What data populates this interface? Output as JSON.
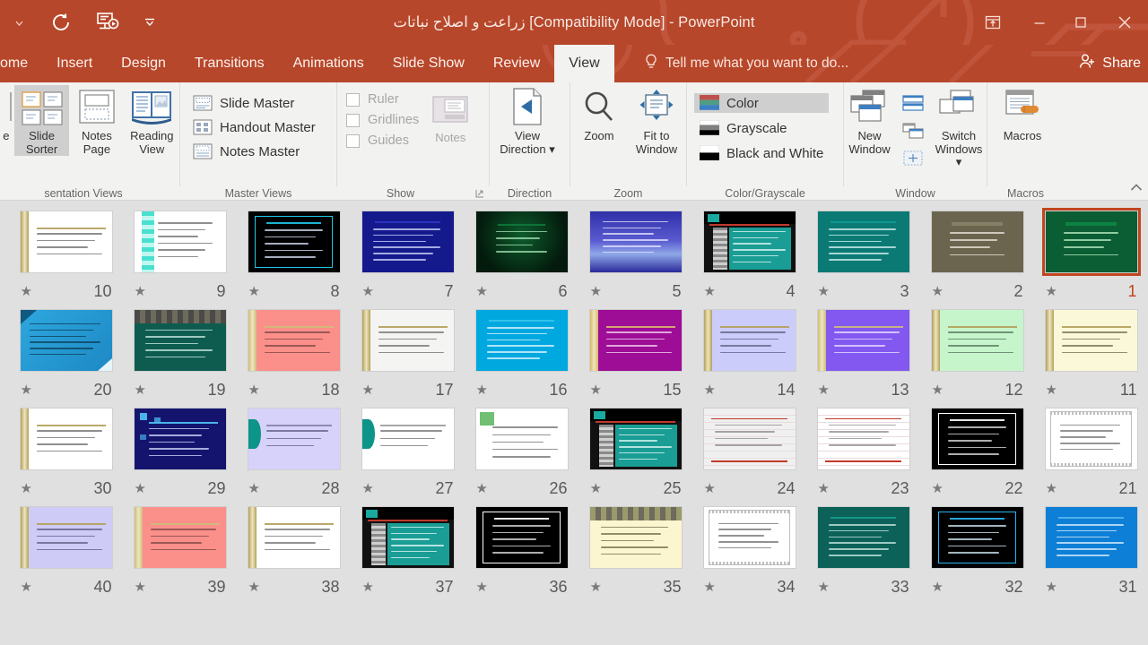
{
  "titlebar": {
    "title": "زراعت و اصلاح نباتات [Compatibility Mode] - PowerPoint",
    "quick_access": [
      {
        "name": "qat-dropdown-left",
        "glyph": "▾"
      },
      {
        "name": "undo-icon",
        "glyph": "↺"
      },
      {
        "name": "start-slideshow-icon",
        "glyph": "⎚"
      },
      {
        "name": "customize-qat-icon",
        "glyph": "▾"
      }
    ],
    "window_controls": [
      {
        "name": "ribbon-display-options-icon",
        "glyph": "⬆"
      },
      {
        "name": "minimize-icon",
        "glyph": "—"
      },
      {
        "name": "restore-icon",
        "glyph": "❐"
      },
      {
        "name": "close-icon",
        "glyph": "✕"
      }
    ]
  },
  "tabs": [
    {
      "label": "ome",
      "active": false
    },
    {
      "label": "Insert",
      "active": false
    },
    {
      "label": "Design",
      "active": false
    },
    {
      "label": "Transitions",
      "active": false
    },
    {
      "label": "Animations",
      "active": false
    },
    {
      "label": "Slide Show",
      "active": false
    },
    {
      "label": "Review",
      "active": false
    },
    {
      "label": "View",
      "active": true
    }
  ],
  "tellme": {
    "placeholder": "Tell me what you want to do...",
    "icon": "lightbulb-icon"
  },
  "share": {
    "label": "Share",
    "icon": "person-add-icon"
  },
  "ribbon": {
    "groups": [
      {
        "name": "presentation-views",
        "label": "sentation Views",
        "buttons": [
          {
            "label": "e",
            "name": "outline-view-button",
            "selected": false
          },
          {
            "label": "Slide\nSorter",
            "name": "slide-sorter-button",
            "selected": true
          },
          {
            "label": "Notes\nPage",
            "name": "notes-page-button",
            "selected": false
          },
          {
            "label": "Reading\nView",
            "name": "reading-view-button",
            "selected": false
          }
        ]
      },
      {
        "name": "master-views",
        "label": "Master Views",
        "items": [
          {
            "label": "Slide Master",
            "name": "slide-master-button"
          },
          {
            "label": "Handout Master",
            "name": "handout-master-button"
          },
          {
            "label": "Notes Master",
            "name": "notes-master-button"
          }
        ]
      },
      {
        "name": "show",
        "label": "Show",
        "checkboxes": [
          {
            "label": "Ruler",
            "checked": false,
            "name": "ruler-checkbox"
          },
          {
            "label": "Gridlines",
            "checked": false,
            "name": "gridlines-checkbox"
          },
          {
            "label": "Guides",
            "checked": false,
            "name": "guides-checkbox"
          }
        ],
        "buttons": [
          {
            "label": "Notes",
            "name": "notes-button",
            "disabled": true
          }
        ]
      },
      {
        "name": "direction",
        "label": "Direction",
        "buttons": [
          {
            "label": "View\nDirection ▾",
            "name": "view-direction-button"
          }
        ]
      },
      {
        "name": "zoom",
        "label": "Zoom",
        "buttons": [
          {
            "label": "Zoom",
            "name": "zoom-button"
          },
          {
            "label": "Fit to\nWindow",
            "name": "fit-to-window-button"
          }
        ]
      },
      {
        "name": "color-grayscale",
        "label": "Color/Grayscale",
        "items": [
          {
            "label": "Color",
            "name": "color-button",
            "selected": true
          },
          {
            "label": "Grayscale",
            "name": "grayscale-button",
            "selected": false
          },
          {
            "label": "Black and White",
            "name": "black-and-white-button",
            "selected": false
          }
        ]
      },
      {
        "name": "window",
        "label": "Window",
        "buttons": [
          {
            "label": "New\nWindow",
            "name": "new-window-button"
          },
          {
            "label": "Switch\nWindows ▾",
            "name": "switch-windows-button"
          }
        ],
        "small_buttons": [
          {
            "name": "arrange-all-button"
          },
          {
            "name": "cascade-button"
          },
          {
            "name": "move-split-button"
          }
        ]
      },
      {
        "name": "macros",
        "label": "Macros",
        "buttons": [
          {
            "label": "Macros",
            "name": "macros-button"
          }
        ]
      }
    ],
    "collapse_glyph": "⌃"
  },
  "slide_sorter": {
    "star_glyph": "★",
    "rows": [
      {
        "slides": [
          {
            "number": "1",
            "selected": true,
            "bg": "#0b5d33",
            "fg": "#bff0c8",
            "style": "title-center",
            "accent": "#0d8a45"
          },
          {
            "number": "2",
            "selected": false,
            "bg": "#6b6550",
            "fg": "#efeadd",
            "style": "title-center",
            "accent": "#8a8468"
          },
          {
            "number": "3",
            "selected": false,
            "bg": "#0b7a74",
            "fg": "#d9f7f5",
            "style": "body",
            "accent": "#0f9a92"
          },
          {
            "number": "4",
            "selected": false,
            "bg": "#111111",
            "fg": "#cfe9e6",
            "style": "dark-split",
            "accent": "#1aa9a0"
          },
          {
            "number": "5",
            "selected": false,
            "bg": "#3b3bb0",
            "fg": "#e4e4ff",
            "style": "gradient-blue",
            "accent": "#6f6fe0"
          },
          {
            "number": "6",
            "selected": false,
            "bg": "#042b13",
            "fg": "#a8e6b8",
            "style": "dark-green",
            "accent": "#0c7a3a"
          },
          {
            "number": "7",
            "selected": false,
            "bg": "#141a8c",
            "fg": "#d6dcff",
            "style": "body",
            "accent": "#2c36c8"
          },
          {
            "number": "8",
            "selected": false,
            "bg": "#000000",
            "fg": "#dfe8ff",
            "style": "black-frame",
            "accent": "#1ec8e8"
          },
          {
            "number": "9",
            "selected": false,
            "bg": "#ffffff",
            "fg": "#6a6a6a",
            "style": "teal-stripe",
            "accent": "#49e0d0"
          },
          {
            "number": "10",
            "selected": false,
            "bg": "#ffffff",
            "fg": "#6a6a6a",
            "style": "gold-stripe",
            "accent": "#b2a05a"
          }
        ]
      },
      {
        "slides": [
          {
            "number": "11",
            "selected": false,
            "bg": "#fbf8d9",
            "fg": "#6f6a4a",
            "style": "gold-stripe",
            "accent": "#b2a05a"
          },
          {
            "number": "12",
            "selected": false,
            "bg": "#c6f5cb",
            "fg": "#51705a",
            "style": "gold-stripe",
            "accent": "#b2a05a"
          },
          {
            "number": "13",
            "selected": false,
            "bg": "#8258f0",
            "fg": "#ece4ff",
            "style": "gold-stripe",
            "accent": "#cdbd7a"
          },
          {
            "number": "14",
            "selected": false,
            "bg": "#ccccfb",
            "fg": "#5c5c82",
            "style": "gold-stripe",
            "accent": "#b2a05a"
          },
          {
            "number": "15",
            "selected": false,
            "bg": "#9e0d96",
            "fg": "#f5d9f3",
            "style": "gold-stripe",
            "accent": "#d8b76a"
          },
          {
            "number": "16",
            "selected": false,
            "bg": "#00a8e0",
            "fg": "#e6f8ff",
            "style": "body",
            "accent": "#35c4f0"
          },
          {
            "number": "17",
            "selected": false,
            "bg": "#f4f4f2",
            "fg": "#6d6d6d",
            "style": "gold-stripe",
            "accent": "#b2a05a"
          },
          {
            "number": "18",
            "selected": false,
            "bg": "#fb8f8a",
            "fg": "#7a4542",
            "style": "gold-stripe",
            "accent": "#cdbd7a"
          },
          {
            "number": "19",
            "selected": false,
            "bg": "#0e5c50",
            "fg": "#cdeee7",
            "style": "photo-top",
            "accent": "#4a4a46"
          },
          {
            "number": "20",
            "selected": false,
            "bg": "#2bafe6",
            "fg": "#0a3d56",
            "style": "fold-blue",
            "accent": "#1a6c95"
          }
        ]
      },
      {
        "slides": [
          {
            "number": "21",
            "selected": false,
            "bg": "#ffffff",
            "fg": "#707070",
            "style": "framed-doc",
            "accent": "#bdbdbd"
          },
          {
            "number": "22",
            "selected": false,
            "bg": "#000000",
            "fg": "#e8e8e8",
            "style": "black-frame",
            "accent": "#ffffff"
          },
          {
            "number": "23",
            "selected": false,
            "bg": "#ffffff",
            "fg": "#777777",
            "style": "ruled-red",
            "accent": "#c0392b"
          },
          {
            "number": "24",
            "selected": false,
            "bg": "#f0f0f0",
            "fg": "#6f6f6f",
            "style": "ruled-red",
            "accent": "#c0392b"
          },
          {
            "number": "25",
            "selected": false,
            "bg": "#111111",
            "fg": "#cfe9e6",
            "style": "dark-split",
            "accent": "#1aa9a0"
          },
          {
            "number": "26",
            "selected": false,
            "bg": "#ffffff",
            "fg": "#6d6d6d",
            "style": "green-stripe",
            "accent": "#4caf50"
          },
          {
            "number": "27",
            "selected": false,
            "bg": "#ffffff",
            "fg": "#6d6d6d",
            "style": "teal-leaf",
            "accent": "#0d9488"
          },
          {
            "number": "28",
            "selected": false,
            "bg": "#d6d2fa",
            "fg": "#5d5a80",
            "style": "teal-leaf",
            "accent": "#0d9488"
          },
          {
            "number": "29",
            "selected": false,
            "bg": "#14146e",
            "fg": "#d8dcff",
            "style": "blue-dots",
            "accent": "#4fc3f7"
          },
          {
            "number": "30",
            "selected": false,
            "bg": "#ffffff",
            "fg": "#6a6a6a",
            "style": "gold-stripe",
            "accent": "#b2a05a"
          }
        ]
      },
      {
        "slides": [
          {
            "number": "31",
            "selected": false,
            "bg": "#0d7fd6",
            "fg": "#e3f2ff",
            "style": "body",
            "accent": "#57b6ef"
          },
          {
            "number": "32",
            "selected": false,
            "bg": "#000000",
            "fg": "#d8f1ff",
            "style": "black-frame",
            "accent": "#29b6f6"
          },
          {
            "number": "33",
            "selected": false,
            "bg": "#0c6158",
            "fg": "#cdeee7",
            "style": "body",
            "accent": "#14a08f"
          },
          {
            "number": "34",
            "selected": false,
            "bg": "#ffffff",
            "fg": "#6d6d6d",
            "style": "framed-doc",
            "accent": "#bdbdbd"
          },
          {
            "number": "35",
            "selected": false,
            "bg": "#fbf6cf",
            "fg": "#6f6a4a",
            "style": "photo-top",
            "accent": "#9a9a6a"
          },
          {
            "number": "36",
            "selected": false,
            "bg": "#000000",
            "fg": "#e8e8e8",
            "style": "black-frame",
            "accent": "#ffffff"
          },
          {
            "number": "37",
            "selected": false,
            "bg": "#111111",
            "fg": "#cfe9e6",
            "style": "dark-split",
            "accent": "#1aa9a0"
          },
          {
            "number": "38",
            "selected": false,
            "bg": "#ffffff",
            "fg": "#6d6d6d",
            "style": "gold-stripe",
            "accent": "#b2a05a"
          },
          {
            "number": "39",
            "selected": false,
            "bg": "#fb8f8a",
            "fg": "#7a4542",
            "style": "gold-stripe",
            "accent": "#cdbd7a"
          },
          {
            "number": "40",
            "selected": false,
            "bg": "#cfcbf7",
            "fg": "#5d5a80",
            "style": "gold-stripe",
            "accent": "#b2a05a"
          }
        ]
      }
    ]
  }
}
